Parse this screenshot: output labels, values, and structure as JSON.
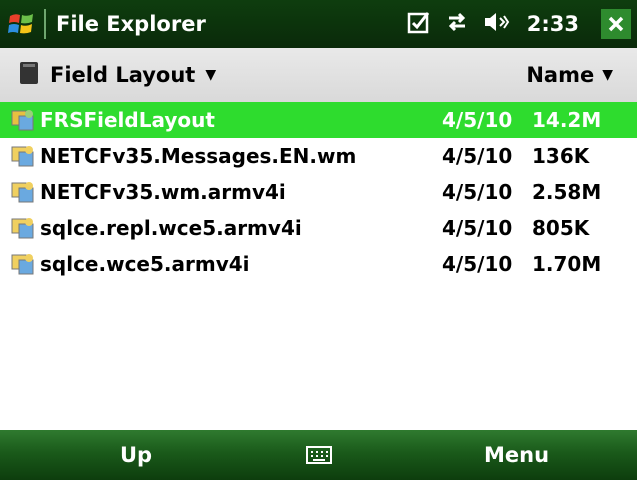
{
  "titlebar": {
    "title": "File Explorer",
    "time": "2:33",
    "icons": [
      "windows-start-icon",
      "notification-check-icon",
      "connectivity-icon",
      "speaker-icon",
      "close-icon"
    ]
  },
  "header": {
    "folder_label": "Field Layout",
    "sort_label": "Name"
  },
  "files": [
    {
      "name": "FRSFieldLayout",
      "date": "4/5/10",
      "size": "14.2M",
      "selected": true
    },
    {
      "name": "NETCFv35.Messages.EN.wm",
      "date": "4/5/10",
      "size": "136K",
      "selected": false
    },
    {
      "name": "NETCFv35.wm.armv4i",
      "date": "4/5/10",
      "size": "2.58M",
      "selected": false
    },
    {
      "name": "sqlce.repl.wce5.armv4i",
      "date": "4/5/10",
      "size": "805K",
      "selected": false
    },
    {
      "name": "sqlce.wce5.armv4i",
      "date": "4/5/10",
      "size": "1.70M",
      "selected": false
    }
  ],
  "softkeys": {
    "left": "Up",
    "right": "Menu"
  },
  "colors": {
    "titlebar": "#0e3d0e",
    "selection": "#2edc2e",
    "softbar": "#1a5a1a",
    "header": "#e0e0e0"
  }
}
